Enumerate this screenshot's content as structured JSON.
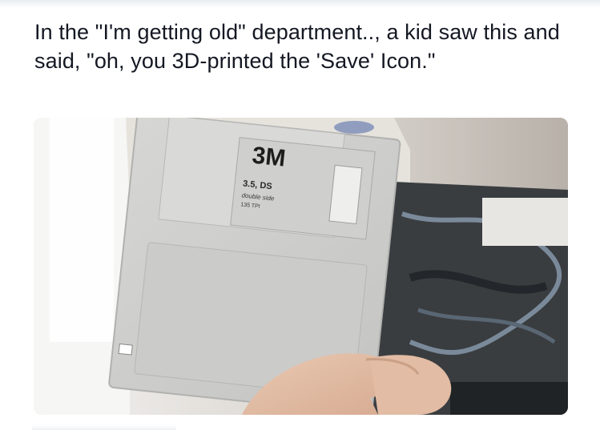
{
  "tweet": {
    "text": "In the \"I'm getting old\" department.., a kid saw this and said, \"oh, you 3D-printed the 'Save' Icon.\""
  },
  "photo": {
    "label": {
      "brand": "3M",
      "line1": "3.5, DS",
      "line2": "double side",
      "line3": "135 TPI"
    }
  }
}
